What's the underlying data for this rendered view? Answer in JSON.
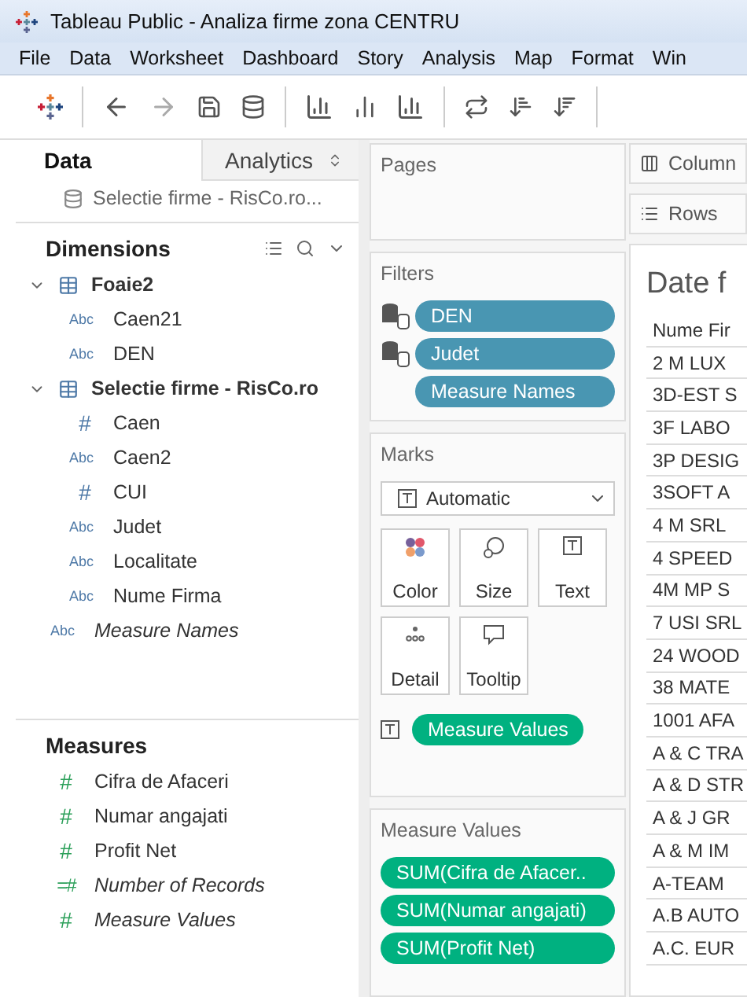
{
  "window": {
    "title": "Tableau Public - Analiza firme zona CENTRU"
  },
  "menu": [
    "File",
    "Data",
    "Worksheet",
    "Dashboard",
    "Story",
    "Analysis",
    "Map",
    "Format",
    "Win"
  ],
  "side_tabs": [
    {
      "label": "Data",
      "selected": true
    },
    {
      "label": "Analytics",
      "selected": false
    }
  ],
  "data_source": "Selectie firme - RisCo.ro...",
  "dimensions": {
    "title": "Dimensions",
    "items": [
      {
        "kind": "table",
        "label": "Foaie2",
        "expanded": true,
        "children": [
          {
            "kind": "text",
            "type_icon": "Abc",
            "label": "Caen21",
            "generated": false
          },
          {
            "kind": "text",
            "type_icon": "Abc",
            "label": "DEN",
            "generated": false
          }
        ]
      },
      {
        "kind": "table",
        "label": "Selectie firme - RisCo.ro",
        "expanded": true,
        "children": [
          {
            "kind": "number",
            "type_icon": "#",
            "label": "Caen",
            "generated": false
          },
          {
            "kind": "text",
            "type_icon": "Abc",
            "label": "Caen2",
            "generated": false
          },
          {
            "kind": "number",
            "type_icon": "#",
            "label": "CUI",
            "generated": false
          },
          {
            "kind": "text",
            "type_icon": "Abc",
            "label": "Judet",
            "generated": false
          },
          {
            "kind": "text",
            "type_icon": "Abc",
            "label": "Localitate",
            "generated": false
          },
          {
            "kind": "text",
            "type_icon": "Abc",
            "label": "Nume Firma",
            "generated": false
          }
        ]
      },
      {
        "kind": "text",
        "type_icon": "Abc",
        "label": "Measure Names",
        "generated": true
      }
    ]
  },
  "measures": {
    "title": "Measures",
    "items": [
      {
        "kind": "number",
        "type_icon": "#",
        "label": "Cifra de Afaceri",
        "generated": false
      },
      {
        "kind": "number",
        "type_icon": "#",
        "label": "Numar angajati",
        "generated": false
      },
      {
        "kind": "number",
        "type_icon": "#",
        "label": "Profit Net",
        "generated": false
      },
      {
        "kind": "count",
        "type_icon": "=#",
        "label": "Number of Records",
        "generated": true
      },
      {
        "kind": "number",
        "type_icon": "#",
        "label": "Measure Values",
        "generated": true
      }
    ]
  },
  "pages": {
    "title": "Pages"
  },
  "filters": {
    "title": "Filters",
    "pills": [
      {
        "label": "DEN",
        "linked": true
      },
      {
        "label": "Judet",
        "linked": true
      },
      {
        "label": "Measure Names",
        "linked": false
      }
    ]
  },
  "marks": {
    "title": "Marks",
    "mark_type": "Automatic",
    "cards": [
      "Color",
      "Size",
      "Text",
      "Detail",
      "Tooltip"
    ],
    "pill": "Measure Values"
  },
  "measure_values": {
    "title": "Measure Values",
    "pills": [
      "SUM(Cifra de Afacer..",
      "SUM(Numar angajati)",
      "SUM(Profit Net)"
    ]
  },
  "shelves": [
    "Column",
    "Rows"
  ],
  "view": {
    "title": "Date f",
    "column_header": "Nume Fir",
    "rows": [
      "2 M LUX",
      "3D-EST S",
      "3F LABO",
      "3P DESIG",
      "3SOFT A",
      "4 M SRL",
      "4 SPEED",
      "4M MP S",
      "7 USI SRL",
      "24 WOOD",
      "38 MATE",
      "1001 AFA",
      "A & C TRA",
      "A & D STR",
      "A & J GR",
      "A & M IM",
      "A-TEAM",
      "A.B AUTO",
      "A.C. EUR"
    ]
  }
}
